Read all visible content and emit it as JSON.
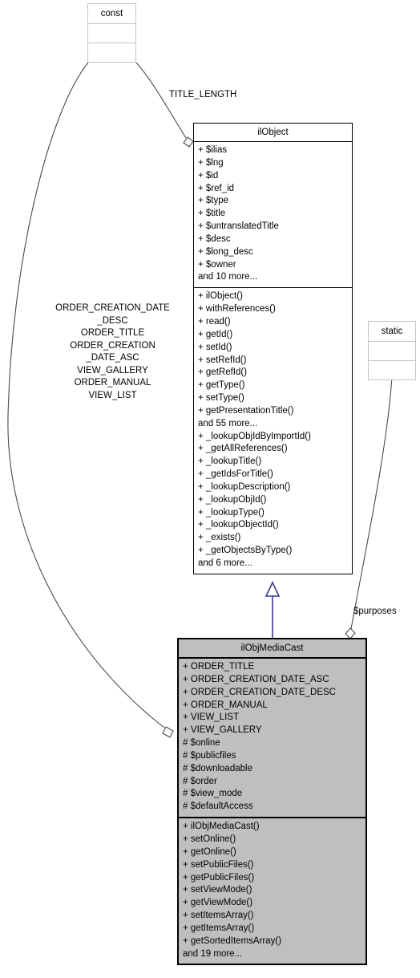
{
  "diagram": {
    "kind": "uml-class-diagram",
    "background_color": "#ffffff",
    "line_color": "#4a4a4a",
    "inheritance_color": "#3b3b8f",
    "node_fill_derived": "#bfbfbf",
    "node_fill_base": "#ffffff"
  },
  "nodes": {
    "const_stub": {
      "title": "const"
    },
    "static_stub": {
      "title": "static"
    },
    "ilobject": {
      "title": "ilObject",
      "attributes": [
        "+ $ilias",
        "+ $lng",
        "+ $id",
        "+ $ref_id",
        "+ $type",
        "+ $title",
        "+ $untranslatedTitle",
        "+ $desc",
        "+ $long_desc",
        "+ $owner",
        "and 10 more..."
      ],
      "operations": [
        "+ ilObject()",
        "+ withReferences()",
        "+ read()",
        "+ getId()",
        "+ setId()",
        "+ setRefId()",
        "+ getRefId()",
        "+ getType()",
        "+ setType()",
        "+ getPresentationTitle()",
        "and 55 more...",
        "+ _lookupObjIdByImportId()",
        "+ _getAllReferences()",
        "+ _lookupTitle()",
        "+ _getIdsForTitle()",
        "+ _lookupDescription()",
        "+ _lookupObjId()",
        "+ _lookupType()",
        "+ _lookupObjectId()",
        "+ _exists()",
        "+ _getObjectsByType()",
        "and 6 more..."
      ]
    },
    "ilobjmediacast": {
      "title": "ilObjMediaCast",
      "attributes": [
        "+ ORDER_TITLE",
        "+ ORDER_CREATION_DATE_ASC",
        "+ ORDER_CREATION_DATE_DESC",
        "+ ORDER_MANUAL",
        "+ VIEW_LIST",
        "+ VIEW_GALLERY",
        "# $online",
        "# $publicfiles",
        "# $downloadable",
        "# $order",
        "# $view_mode",
        "# $defaultAccess"
      ],
      "operations": [
        "+ ilObjMediaCast()",
        "+ setOnline()",
        "+ getOnline()",
        "+ setPublicFiles()",
        "+ getPublicFiles()",
        "+ setViewMode()",
        "+ getViewMode()",
        "+ setItemsArray()",
        "+ getItemsArray()",
        "+ getSortedItemsArray()",
        "and 19 more..."
      ]
    }
  },
  "edges": {
    "const_to_ilobject": {
      "label": "TITLE_LENGTH"
    },
    "const_to_ilobjmediacast": {
      "label": "ORDER_CREATION_DATE\n_DESC\nORDER_TITLE\nORDER_CREATION\n_DATE_ASC\nVIEW_GALLERY\nORDER_MANUAL\nVIEW_LIST"
    },
    "static_to_ilobjmediacast": {
      "label": "$purposes"
    },
    "inheritance": {
      "label": ""
    }
  }
}
